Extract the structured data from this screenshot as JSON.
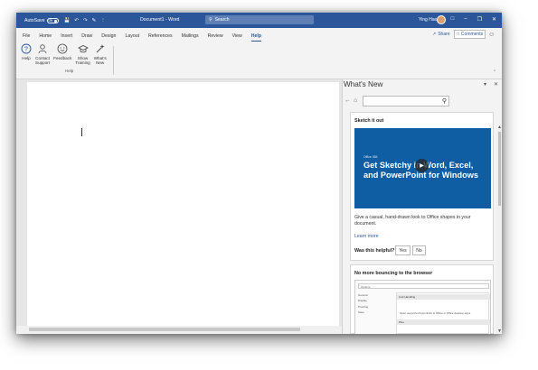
{
  "titlebar": {
    "autosave_label": "AutoSave",
    "autosave_state": "Off",
    "doc_title": "Document1  -  Word",
    "search_placeholder": "Search",
    "user_name": "Ying Hao",
    "color": "#2b579a"
  },
  "ribbon": {
    "tabs": [
      "File",
      "Home",
      "Insert",
      "Draw",
      "Design",
      "Layout",
      "References",
      "Mailings",
      "Review",
      "View",
      "Help"
    ],
    "active_tab": "Help",
    "share_label": "Share",
    "comments_label": "Comments",
    "buttons": [
      {
        "label_line1": "Help",
        "label_line2": "",
        "icon": "help-icon"
      },
      {
        "label_line1": "Contact",
        "label_line2": "Support",
        "icon": "contact-support-icon"
      },
      {
        "label_line1": "Feedback",
        "label_line2": "",
        "icon": "feedback-icon"
      },
      {
        "label_line1": "Show",
        "label_line2": "Training",
        "icon": "training-icon"
      },
      {
        "label_line1": "What's",
        "label_line2": "New",
        "icon": "whats-new-icon"
      }
    ],
    "group_label": "Help"
  },
  "pane": {
    "title": "What's New",
    "card1": {
      "title": "Sketch it out",
      "hero_sub": "Office 365",
      "hero_text": "Get Sketchy in Word, Excel, and PowerPoint for Windows",
      "description": "Give a casual, hand-drawn look to Office shapes in your document.",
      "learn_more": "Learn more",
      "helpful_label": "Was this helpful?",
      "yes_label": "Yes",
      "no_label": "No"
    },
    "card2": {
      "title": "No more bouncing to the browser",
      "shot_header": "Options",
      "shot_list": [
        "General",
        "Display",
        "Proofing",
        "Save"
      ],
      "shot_row1": "Link Handling",
      "shot_check": "Open supported hyperlinks to Office in Office desktop apps",
      "shot_row2": "Plus"
    }
  }
}
